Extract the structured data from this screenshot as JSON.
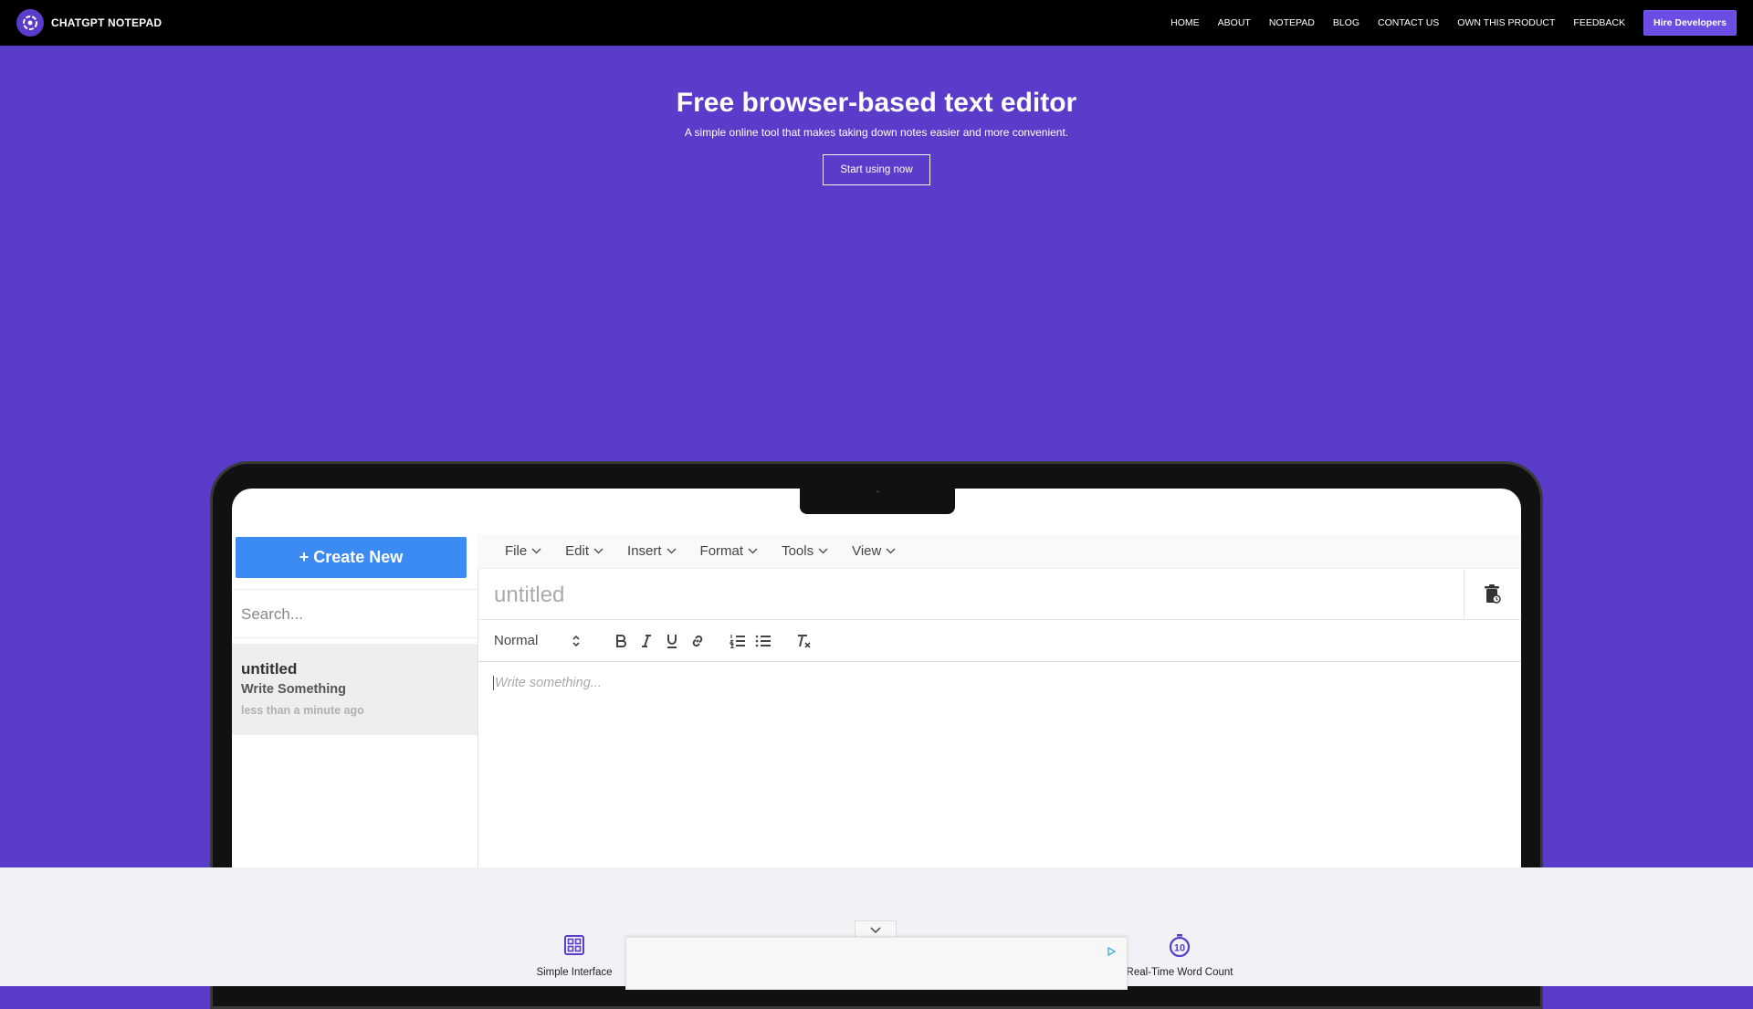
{
  "nav": {
    "brand": "CHATGPT NOTEPAD",
    "links": [
      "HOME",
      "ABOUT",
      "NOTEPAD",
      "BLOG",
      "CONTACT US",
      "OWN THIS PRODUCT",
      "FEEDBACK"
    ],
    "cta": "Hire Developers"
  },
  "hero": {
    "title": "Free browser-based text editor",
    "subtitle": "A simple online tool that makes taking down notes easier and more convenient.",
    "button": "Start using now"
  },
  "app": {
    "create_label": "+ Create New",
    "search_placeholder": "Search...",
    "note": {
      "title": "untitled",
      "subtitle": "Write Something",
      "time": "less than a minute ago"
    },
    "menu": [
      "File",
      "Edit",
      "Insert",
      "Format",
      "Tools",
      "View"
    ],
    "title_placeholder": "untitled",
    "format_select": "Normal",
    "editor_placeholder": "Write something..."
  },
  "features": [
    {
      "label": "Simple Interface",
      "icon": "grid-icon"
    },
    {
      "label": "Real-Time Word Count",
      "icon": "timer-icon"
    }
  ],
  "colors": {
    "brand": "#5b3bc9",
    "button_blue": "#3b8bf2",
    "hire_button": "#6b4de6"
  }
}
